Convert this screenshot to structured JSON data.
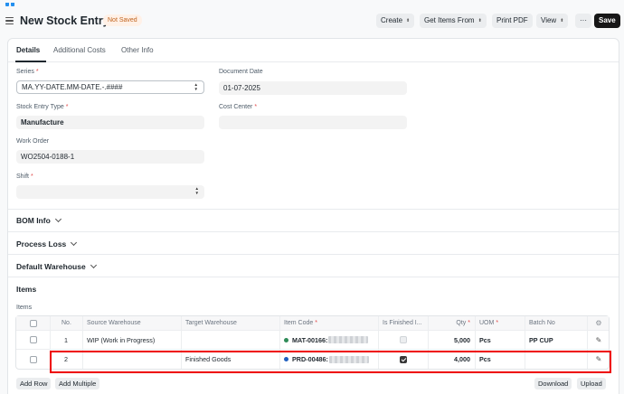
{
  "header": {
    "title": "New Stock Entry",
    "status": "Not Saved",
    "buttons": {
      "create": "Create",
      "get_items_from": "Get Items From",
      "print_pdf": "Print PDF",
      "view": "View",
      "more": "···",
      "save": "Save"
    }
  },
  "tabs": [
    "Details",
    "Additional Costs",
    "Other Info"
  ],
  "fields": {
    "series": {
      "label": "Series",
      "value": "MA.YY-DATE.MM-DATE.-.####"
    },
    "document_date": {
      "label": "Document Date",
      "value": "01-07-2025"
    },
    "stock_entry_type": {
      "label": "Stock Entry Type",
      "value": "Manufacture"
    },
    "cost_center": {
      "label": "Cost Center",
      "value": ""
    },
    "work_order": {
      "label": "Work Order",
      "value": "WO2504-0188-1"
    },
    "shift": {
      "label": "Shift",
      "value": ""
    }
  },
  "sections": {
    "bom_info": "BOM Info",
    "process_loss": "Process Loss",
    "default_warehouse": "Default Warehouse",
    "items": "Items"
  },
  "items_table": {
    "label": "Items",
    "columns": [
      "No.",
      "Source Warehouse",
      "Target Warehouse",
      "Item Code",
      "Is Finished I...",
      "Qty",
      "UOM",
      "Batch No"
    ],
    "rows": [
      {
        "no": "1",
        "source": "WIP (Work in Progress)",
        "target": "",
        "item_code": "MAT-00166:",
        "is_finished": false,
        "qty": "5,000",
        "uom": "Pcs",
        "batch": "PP CUP"
      },
      {
        "no": "2",
        "source": "",
        "target": "Finished Goods",
        "item_code": "PRD-00486:",
        "is_finished": true,
        "qty": "4,000",
        "uom": "Pcs",
        "batch": ""
      }
    ],
    "buttons": {
      "add_row": "Add Row",
      "add_multiple": "Add Multiple",
      "download": "Download",
      "upload": "Upload"
    }
  },
  "colors": {
    "required": "#e24c4c",
    "highlight": "#ee0000",
    "status_badge_text": "#c0631d",
    "item_dot_1": "#2e8b57",
    "item_dot_2": "#1f5fbf"
  }
}
